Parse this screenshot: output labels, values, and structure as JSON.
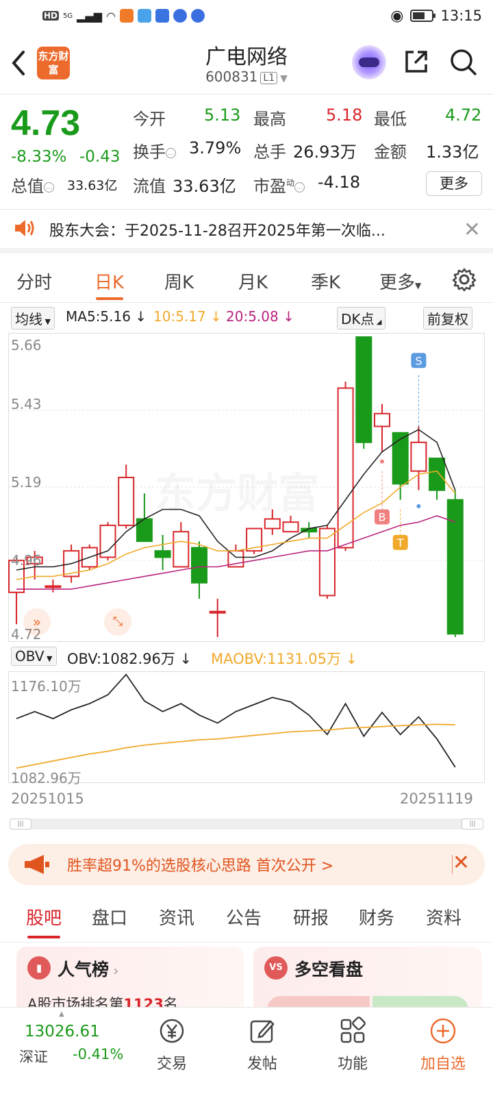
{
  "status": {
    "time": "13:15",
    "net": "5G",
    "hd": "HD"
  },
  "header": {
    "back": "<",
    "logo": "东方财富",
    "title": "广电网络",
    "code": "600831",
    "level": "L1"
  },
  "quote": {
    "price": "4.73",
    "pct": "-8.33%",
    "change": "-0.43",
    "open_label": "今开",
    "open": "5.13",
    "high_label": "最高",
    "high": "5.18",
    "low_label": "最低",
    "low": "4.72",
    "turnover_label": "换手",
    "turnover": "3.79%",
    "volume_label": "总手",
    "volume": "26.93万",
    "amount_label": "金额",
    "amount": "1.33亿",
    "mktcap_label": "总值",
    "mktcap": "33.63亿",
    "float_label": "流值",
    "float": "33.63亿",
    "pe_label": "市盈",
    "pe_sup": "动",
    "pe": "-4.18",
    "more": "更多"
  },
  "notice": {
    "text": "股东大会：于2025-11-28召开2025年第一次临..."
  },
  "period_tabs": [
    "分时",
    "日K",
    "周K",
    "月K",
    "季K",
    "更多"
  ],
  "ma": {
    "type": "均线",
    "ma5": "MA5:5.16",
    "ma10": "10:5.17",
    "ma20": "20:5.08",
    "dk": "DK点",
    "fq": "前复权"
  },
  "kline": {
    "ylabels": [
      "5.66",
      "5.43",
      "5.19",
      "4.96",
      "4.72"
    ],
    "markers": [
      "S",
      "B",
      "T"
    ],
    "watermark": "东方财富"
  },
  "obv": {
    "type": "OBV",
    "obv": "OBV:1082.96万",
    "maobv": "MAOBV:1131.05万",
    "ymax": "1176.10万",
    "ymin": "1082.96万",
    "date_start": "20251015",
    "date_end": "20251119"
  },
  "promo": {
    "text": "胜率超91%的选股核心思路 首次公开 >"
  },
  "bottom_tabs": [
    "股吧",
    "盘口",
    "资讯",
    "公告",
    "研报",
    "财务",
    "资料"
  ],
  "cards": {
    "left_title": "人气榜",
    "left_sub_prefix": "A股市场排名第",
    "left_rank": "1123",
    "left_sub_suffix": "名",
    "right_title": "多空看盘"
  },
  "bottombar": {
    "index_value": "13026.61",
    "index_name": "深证",
    "index_pct": "-0.41%",
    "items": [
      "交易",
      "发帖",
      "功能",
      "加自选"
    ]
  },
  "colors": {
    "up": "#d8252a",
    "down": "#1a9a1a",
    "accent": "#ec6a2c",
    "ma5": "#222222",
    "ma10": "#f0a92a",
    "ma20": "#b8237e"
  },
  "chart_data": [
    {
      "type": "candlestick",
      "title": "日K",
      "ylim": [
        4.72,
        5.66
      ],
      "candles": [
        {
          "o": 4.86,
          "c": 4.96,
          "h": 4.97,
          "l": 4.76
        },
        {
          "o": 4.95,
          "c": 4.97,
          "h": 4.99,
          "l": 4.9
        },
        {
          "o": 4.88,
          "c": 4.88,
          "h": 4.9,
          "l": 4.86
        },
        {
          "o": 4.91,
          "c": 4.99,
          "h": 5.01,
          "l": 4.89
        },
        {
          "o": 4.94,
          "c": 5.0,
          "h": 5.01,
          "l": 4.93
        },
        {
          "o": 4.97,
          "c": 5.07,
          "h": 5.08,
          "l": 4.96
        },
        {
          "o": 5.07,
          "c": 5.22,
          "h": 5.26,
          "l": 5.06
        },
        {
          "o": 5.09,
          "c": 5.02,
          "h": 5.17,
          "l": 5.02
        },
        {
          "o": 4.99,
          "c": 4.97,
          "h": 5.04,
          "l": 4.93
        },
        {
          "o": 4.94,
          "c": 5.05,
          "h": 5.08,
          "l": 4.94
        },
        {
          "o": 5.0,
          "c": 4.89,
          "h": 5.02,
          "l": 4.84
        },
        {
          "o": 4.8,
          "c": 4.8,
          "h": 4.84,
          "l": 4.72
        },
        {
          "o": 4.94,
          "c": 4.99,
          "h": 5.01,
          "l": 4.94
        },
        {
          "o": 4.99,
          "c": 5.06,
          "h": 5.06,
          "l": 4.98
        },
        {
          "o": 5.06,
          "c": 5.09,
          "h": 5.12,
          "l": 5.04
        },
        {
          "o": 5.05,
          "c": 5.08,
          "h": 5.1,
          "l": 5.05
        },
        {
          "o": 5.06,
          "c": 5.05,
          "h": 5.08,
          "l": 5.03
        },
        {
          "o": 4.85,
          "c": 5.06,
          "h": 5.07,
          "l": 4.84
        },
        {
          "o": 5.0,
          "c": 5.5,
          "h": 5.52,
          "l": 4.99
        },
        {
          "o": 5.66,
          "c": 5.33,
          "h": 5.66,
          "l": 5.31
        },
        {
          "o": 5.38,
          "c": 5.42,
          "h": 5.45,
          "l": 5.3
        },
        {
          "o": 5.36,
          "c": 5.2,
          "h": 5.36,
          "l": 5.15
        },
        {
          "o": 5.24,
          "c": 5.33,
          "h": 5.38,
          "l": 5.18
        },
        {
          "o": 5.28,
          "c": 5.18,
          "h": 5.28,
          "l": 5.15
        },
        {
          "o": 5.15,
          "c": 4.73,
          "h": 5.18,
          "l": 4.72
        }
      ],
      "series": [
        {
          "name": "MA5",
          "values": [
            4.93,
            4.94,
            4.94,
            4.95,
            4.97,
            4.99,
            5.05,
            5.09,
            5.12,
            5.12,
            5.1,
            5.02,
            4.97,
            4.97,
            4.99,
            5.03,
            5.06,
            5.07,
            5.15,
            5.23,
            5.3,
            5.34,
            5.37,
            5.33,
            5.18
          ]
        },
        {
          "name": "MA10",
          "values": [
            4.9,
            4.91,
            4.91,
            4.92,
            4.93,
            4.95,
            4.98,
            5.0,
            5.01,
            5.02,
            5.01,
            4.99,
            4.99,
            5.0,
            5.01,
            5.02,
            5.03,
            5.03,
            5.07,
            5.11,
            5.14,
            5.19,
            5.23,
            5.24,
            5.17
          ]
        },
        {
          "name": "MA20",
          "values": [
            4.87,
            4.87,
            4.87,
            4.87,
            4.88,
            4.89,
            4.9,
            4.91,
            4.92,
            4.93,
            4.94,
            4.94,
            4.95,
            4.96,
            4.97,
            4.98,
            4.99,
            4.99,
            5.01,
            5.03,
            5.05,
            5.07,
            5.08,
            5.1,
            5.08
          ]
        }
      ]
    },
    {
      "type": "line",
      "title": "OBV",
      "ylim": [
        1082.96,
        1176.1
      ],
      "series": [
        {
          "name": "OBV",
          "values": [
            1138,
            1146,
            1138,
            1148,
            1155,
            1165,
            1188,
            1158,
            1146,
            1155,
            1142,
            1133,
            1146,
            1154,
            1162,
            1157,
            1142,
            1120,
            1155,
            1118,
            1145,
            1120,
            1140,
            1115,
            1082.96
          ]
        },
        {
          "name": "MAOBV",
          "values": [
            1082,
            1086,
            1090,
            1094,
            1098,
            1101,
            1105,
            1108,
            1110,
            1112,
            1114,
            1115,
            1117,
            1119,
            1121,
            1123,
            1124,
            1125,
            1127,
            1128,
            1129,
            1130,
            1131,
            1131.5,
            1131.05
          ]
        }
      ]
    }
  ]
}
